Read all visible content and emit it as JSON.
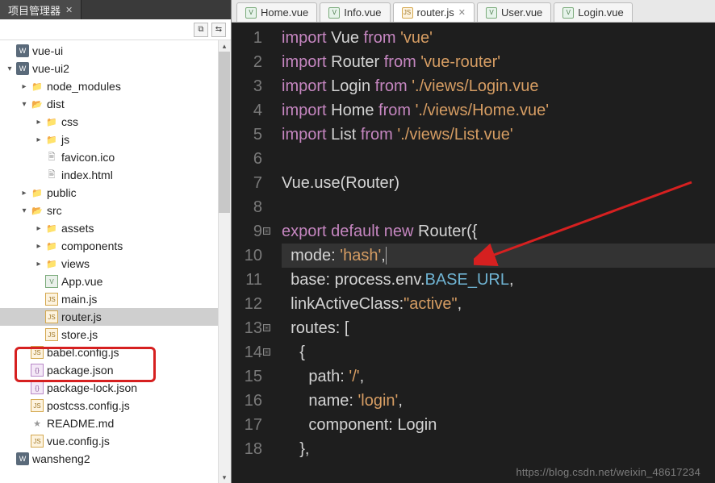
{
  "panel": {
    "title": "项目管理器"
  },
  "toolbar": {
    "btn1": "⧉",
    "btn2": "⇆"
  },
  "tree": {
    "items": [
      {
        "ind": 1,
        "tw": "",
        "icon": "proj",
        "glyph": "W",
        "label": "vue-ui"
      },
      {
        "ind": 1,
        "tw": "▾",
        "icon": "proj",
        "glyph": "W",
        "label": "vue-ui2"
      },
      {
        "ind": 2,
        "tw": "▸",
        "icon": "folder-o",
        "glyph": "📁",
        "label": "node_modules"
      },
      {
        "ind": 2,
        "tw": "▾",
        "icon": "folder",
        "glyph": "📂",
        "label": "dist"
      },
      {
        "ind": 3,
        "tw": "▸",
        "icon": "folder-o",
        "glyph": "📁",
        "label": "css"
      },
      {
        "ind": 3,
        "tw": "▸",
        "icon": "folder-o",
        "glyph": "📁",
        "label": "js"
      },
      {
        "ind": 3,
        "tw": "",
        "icon": "file",
        "glyph": "🖹",
        "label": "favicon.ico"
      },
      {
        "ind": 3,
        "tw": "",
        "icon": "file",
        "glyph": "🖹",
        "label": "index.html"
      },
      {
        "ind": 2,
        "tw": "▸",
        "icon": "folder-o",
        "glyph": "📁",
        "label": "public"
      },
      {
        "ind": 2,
        "tw": "▾",
        "icon": "folder",
        "glyph": "📂",
        "label": "src"
      },
      {
        "ind": 3,
        "tw": "▸",
        "icon": "folder-o",
        "glyph": "📁",
        "label": "assets"
      },
      {
        "ind": 3,
        "tw": "▸",
        "icon": "folder-o",
        "glyph": "📁",
        "label": "components"
      },
      {
        "ind": 3,
        "tw": "▸",
        "icon": "folder-o",
        "glyph": "📁",
        "label": "views"
      },
      {
        "ind": 3,
        "tw": "",
        "icon": "vue",
        "glyph": "V",
        "label": "App.vue"
      },
      {
        "ind": 3,
        "tw": "",
        "icon": "js",
        "glyph": "JS",
        "label": "main.js"
      },
      {
        "ind": 3,
        "tw": "",
        "icon": "js",
        "glyph": "JS",
        "label": "router.js",
        "selected": true
      },
      {
        "ind": 3,
        "tw": "",
        "icon": "js",
        "glyph": "JS",
        "label": "store.js"
      },
      {
        "ind": 2,
        "tw": "",
        "icon": "js",
        "glyph": "JS",
        "label": "babel.config.js"
      },
      {
        "ind": 2,
        "tw": "",
        "icon": "json",
        "glyph": "{}",
        "label": "package.json"
      },
      {
        "ind": 2,
        "tw": "",
        "icon": "json",
        "glyph": "{}",
        "label": "package-lock.json"
      },
      {
        "ind": 2,
        "tw": "",
        "icon": "js",
        "glyph": "JS",
        "label": "postcss.config.js"
      },
      {
        "ind": 2,
        "tw": "",
        "icon": "md",
        "glyph": "★",
        "label": "README.md"
      },
      {
        "ind": 2,
        "tw": "",
        "icon": "js",
        "glyph": "JS",
        "label": "vue.config.js"
      },
      {
        "ind": 1,
        "tw": "",
        "icon": "proj",
        "glyph": "W",
        "label": "wansheng2"
      }
    ]
  },
  "editor_tabs": [
    {
      "icon": "vue",
      "glyph": "V",
      "label": "Home.vue",
      "active": false,
      "close": false
    },
    {
      "icon": "vue",
      "glyph": "V",
      "label": "Info.vue",
      "active": false,
      "close": false
    },
    {
      "icon": "js",
      "glyph": "JS",
      "label": "router.js",
      "active": true,
      "close": true
    },
    {
      "icon": "vue",
      "glyph": "V",
      "label": "User.vue",
      "active": false,
      "close": false
    },
    {
      "icon": "vue",
      "glyph": "V",
      "label": "Login.vue",
      "active": false,
      "close": false
    }
  ],
  "code": {
    "lines": [
      {
        "n": 1,
        "html": "<span class='kw1'>import</span> Vue <span class='kw1'>from</span> <span class='str'>'vue'</span>"
      },
      {
        "n": 2,
        "html": "<span class='kw1'>import</span> Router <span class='kw1'>from</span> <span class='str'>'vue-router'</span>"
      },
      {
        "n": 3,
        "html": "<span class='kw1'>import</span> Login <span class='kw1'>from</span> <span class='str'>'./views/Login.vue</span>"
      },
      {
        "n": 4,
        "html": "<span class='kw1'>import</span> Home <span class='kw1'>from</span> <span class='str'>'./views/Home.vue'</span>"
      },
      {
        "n": 5,
        "html": "<span class='kw1'>import</span> List <span class='kw1'>from</span> <span class='str'>'./views/List.vue'</span>"
      },
      {
        "n": 6,
        "html": ""
      },
      {
        "n": 7,
        "html": "Vue.use(Router)"
      },
      {
        "n": 8,
        "html": ""
      },
      {
        "n": 9,
        "fold": "-",
        "html": "<span class='kw1'>export</span> <span class='kw1'>default</span> <span class='kw1'>new</span> Router({"
      },
      {
        "n": 10,
        "hl": true,
        "html": "  mode: <span class='str'>'hash'</span>,<span style='border-left:1px solid #aaa;height:20px;'></span>"
      },
      {
        "n": 11,
        "html": "  base: process.env.<span class='env'>BASE_URL</span>,"
      },
      {
        "n": 12,
        "html": "  linkActiveClass:<span class='str'>\"active\"</span>,"
      },
      {
        "n": 13,
        "fold": "-",
        "html": "  routes: ["
      },
      {
        "n": 14,
        "fold": "-",
        "html": "    {"
      },
      {
        "n": 15,
        "html": "      path: <span class='str'>'/'</span>,"
      },
      {
        "n": 16,
        "html": "      name: <span class='str'>'login'</span>,"
      },
      {
        "n": 17,
        "html": "      component: Login"
      },
      {
        "n": 18,
        "html": "    },"
      }
    ]
  },
  "watermark": "https://blog.csdn.net/weixin_48617234"
}
